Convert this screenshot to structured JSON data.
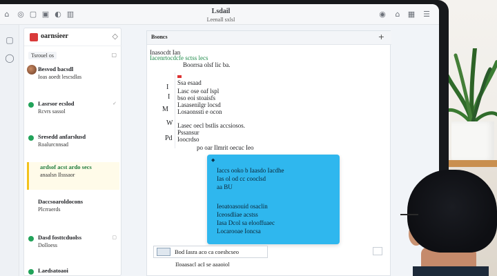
{
  "window": {
    "title": "Lsdail",
    "subtitle": "Leenall sxlsl"
  },
  "rail": {
    "icons": [
      "window-icon",
      "compose-icon"
    ]
  },
  "conversation_list": {
    "title": "oarnsieer",
    "filter_label": "Tsrouel os",
    "items": [
      {
        "name": "Besvod bacsdl",
        "snippet": "Ioas aoedt lescsdlas",
        "type": "avatar"
      },
      {
        "name": "Lasrsor ecslod",
        "snippet": "Rcvrs sassol",
        "type": "dot"
      },
      {
        "name": "Sresedd anfarslusd",
        "snippet": "Roalurcnnsad",
        "type": "dot"
      },
      {
        "name": "ardsof acst ardo secs",
        "snippet": "anaalsn Ilsssaor",
        "type": "active"
      },
      {
        "name": "Daccsoaroldocons",
        "snippet": "Plcrraerds",
        "type": "none"
      },
      {
        "name": "Dasd fosttcduolss",
        "snippet": "Dolloess",
        "type": "dot"
      },
      {
        "name": "Laedsatoaoi",
        "snippet": "",
        "type": "dot"
      }
    ]
  },
  "chat": {
    "header_title": "Bsoncs",
    "close": "+",
    "lines": [
      {
        "text": "Inasocdt Ian",
        "hl": false
      },
      {
        "text": "Iacenrtocdcfe sctss lecs",
        "hl": false
      },
      {
        "text": "Boorrsa olsf lic ba.",
        "hl": false
      },
      {
        "text": "Ssa esaad",
        "hl": false
      },
      {
        "text": "Lasc ose oaf lspl",
        "hl": false
      },
      {
        "text": "bso eoi stoaisfs",
        "hl": false
      },
      {
        "text": "Lasasenilgr locsd",
        "hl": false
      },
      {
        "text": "Losaonssti e ocon",
        "hl": false
      },
      {
        "text": "Lasec oecl bstlis accsiosos.",
        "hl": false
      },
      {
        "text": "Pssansur",
        "hl": false
      },
      {
        "text": "Ioocrdso",
        "hl": false
      },
      {
        "text": "po oar Ilmrit oecuc Ieo",
        "hl": false
      }
    ],
    "side_marks": [
      "I",
      "I",
      "M",
      "W",
      "Pd"
    ]
  },
  "reply_card": {
    "pin_icon": "pin-icon",
    "lines": [
      "Iaccs ooko b Iaasdo Iacdhe",
      "Ias ol od cc cooclsd",
      "aa BU",
      "Ieoatoasouid osaclin",
      "Iceosdliae acstss",
      "Iasa Dcol sa elooffuaec",
      "Locarooae Ioncsa"
    ]
  },
  "compose": {
    "text": "Bod Iasra aco ca coeshcseo",
    "status": "Iloaasacl acI se aaaoiol"
  },
  "colors": {
    "accent": "#2fb7ee",
    "online": "#22a35a",
    "active_bar": "#f2c21b",
    "logo": "#d93a3a"
  }
}
